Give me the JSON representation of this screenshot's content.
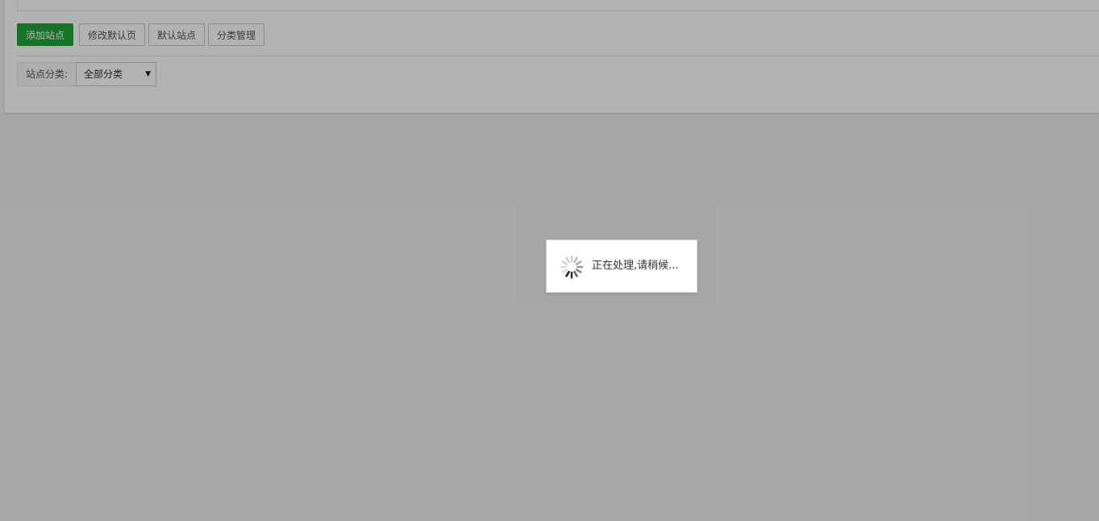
{
  "toolbar": {
    "add_site": "添加站点",
    "edit_default_page": "修改默认页",
    "default_site": "默认站点",
    "category_manage": "分类管理"
  },
  "filter": {
    "label": "站点分类:",
    "selected": "全部分类"
  },
  "loading": {
    "message": "正在处理,请稍候..."
  },
  "colors": {
    "primary": "#20a53a",
    "overlay": "rgba(0,0,0,0.3)"
  },
  "icons": {
    "dropdown": "caret-down-icon",
    "loading": "spinner-icon"
  }
}
